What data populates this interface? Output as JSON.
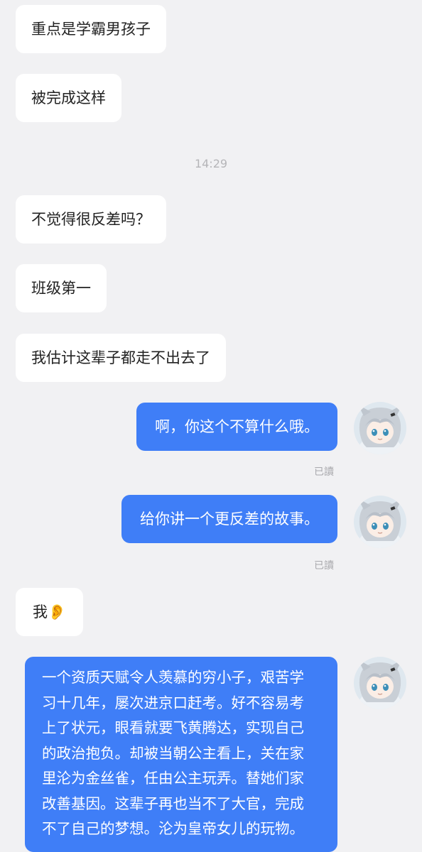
{
  "chat": {
    "timestamp": "14:29",
    "messages": [
      {
        "side": "in",
        "text": "重点是学霸男孩子"
      },
      {
        "side": "in",
        "text": "被完成这样"
      },
      {
        "side": "in",
        "text": "不觉得很反差吗？"
      },
      {
        "side": "in",
        "text": "班级第一"
      },
      {
        "side": "in",
        "text": "我估计这辈子都走不出去了"
      },
      {
        "side": "out",
        "text": "啊，你这个不算什么哦。",
        "receipt": "已讀"
      },
      {
        "side": "out",
        "text": "给你讲一个更反差的故事。",
        "receipt": "已讀"
      },
      {
        "side": "in",
        "text": "我👂"
      },
      {
        "side": "out",
        "text": "一个资质天赋令人羡慕的穷小子，艰苦学\n习十几年，屡次进京口赶考。好不容易考\n上了状元，眼看就要飞黄腾达，实现自己\n的政治抱负。却被当朝公主看上，关在家\n里沦为金丝雀，任由公主玩弄。替她们家\n改善基因。这辈子再也当不了大官，完成\n不了自己的梦想。沦为皇帝女儿的玩物。"
      }
    ]
  },
  "colors": {
    "background": "#f1f1f3",
    "incoming_bubble": "#ffffff",
    "outgoing_bubble": "#3f7ef7"
  },
  "avatar": {
    "icon": "anime-girl-avatar-icon"
  }
}
